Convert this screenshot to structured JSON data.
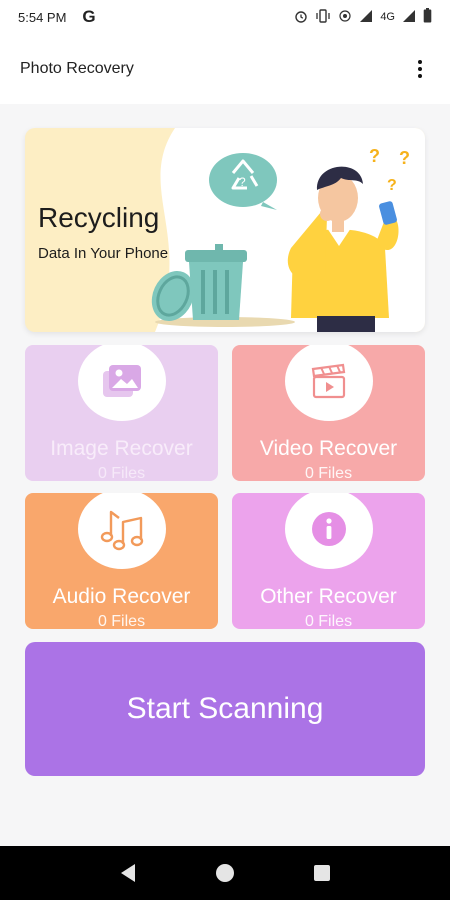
{
  "status_bar": {
    "time": "5:54 PM",
    "network_label": "4G"
  },
  "app_bar": {
    "title": "Photo Recovery",
    "menu_icon": "more-vert-icon"
  },
  "banner": {
    "title": "Recycling",
    "subtitle": "Data In Your Phone"
  },
  "tiles": [
    {
      "label": "Image Recover",
      "count": "0 Files",
      "icon": "image-icon",
      "color": "#e9cff0"
    },
    {
      "label": "Video Recover",
      "count": "0 Files",
      "icon": "video-clapper-icon",
      "color": "#f7a9a9"
    },
    {
      "label": "Audio Recover",
      "count": "0 Files",
      "icon": "music-note-icon",
      "color": "#f9a76c"
    },
    {
      "label": "Other Recover",
      "count": "0 Files",
      "icon": "info-icon",
      "color": "#eca3ec"
    }
  ],
  "scan_button": {
    "label": "Start Scanning",
    "color": "#ab73e6"
  },
  "nav_bar": {
    "items": [
      "back-icon",
      "home-icon",
      "recents-icon"
    ]
  }
}
